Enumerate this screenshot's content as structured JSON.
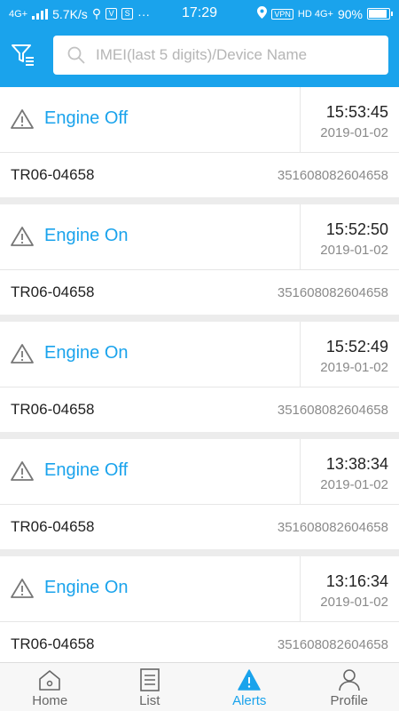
{
  "status_bar": {
    "network_left": "4G+",
    "speed": "5.7K/s",
    "more": "···",
    "time": "17:29",
    "vpn": "VPN",
    "network_right": "HD 4G+",
    "battery": "90%"
  },
  "header": {
    "filter_icon": "filter-icon",
    "search_placeholder": "IMEI(last 5 digits)/Device Name"
  },
  "alerts": [
    {
      "event": "Engine Off",
      "time": "15:53:45",
      "date": "2019-01-02",
      "device": "TR06-04658",
      "imei": "351608082604658"
    },
    {
      "event": "Engine On",
      "time": "15:52:50",
      "date": "2019-01-02",
      "device": "TR06-04658",
      "imei": "351608082604658"
    },
    {
      "event": "Engine On",
      "time": "15:52:49",
      "date": "2019-01-02",
      "device": "TR06-04658",
      "imei": "351608082604658"
    },
    {
      "event": "Engine Off",
      "time": "13:38:34",
      "date": "2019-01-02",
      "device": "TR06-04658",
      "imei": "351608082604658"
    },
    {
      "event": "Engine On",
      "time": "13:16:34",
      "date": "2019-01-02",
      "device": "TR06-04658",
      "imei": "351608082604658"
    }
  ],
  "nav": {
    "home": "Home",
    "list": "List",
    "alerts": "Alerts",
    "profile": "Profile",
    "active": "alerts"
  },
  "colors": {
    "accent": "#1aa3ec",
    "background": "#ececec"
  }
}
